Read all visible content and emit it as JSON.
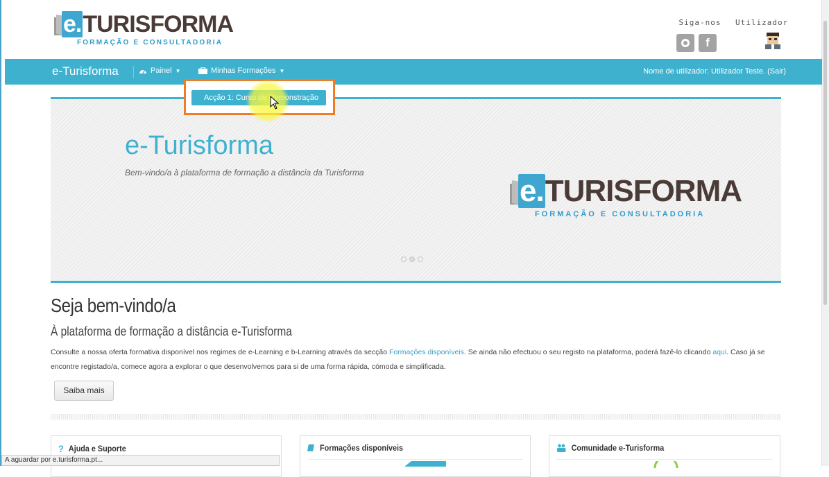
{
  "header": {
    "logo_text_e": "e.",
    "logo_text_rest": "TURISFORMA",
    "logo_tagline": "FORMAÇÃO E CONSULTADORIA",
    "follow_label": "Siga-nos",
    "user_label": "Utilizador"
  },
  "navbar": {
    "brand": "e-Turisforma",
    "panel": "Painel",
    "my_courses": "Minhas Formações",
    "user_text": "Nome de utilizador: Utilizador Teste. (Sair)"
  },
  "dropdown": {
    "item": "Acção 1: Curso de Demonstração"
  },
  "hero": {
    "title": "e-Turisforma",
    "subtitle": "Bem-vindo/a à plataforma de formação a distância da Turisforma",
    "logo_text_e": "e.",
    "logo_text_rest": "TURISFORMA",
    "logo_tagline": "FORMAÇÃO E CONSULTADORIA"
  },
  "welcome": {
    "title": "Seja bem-vindo/a",
    "subtitle": "À plataforma de formação a distância e-Turisforma",
    "text_1": "Consulte a nossa oferta formativa disponível nos regimes de e-Learning e b-Learning através da secção ",
    "link_1": "Formações disponíveis",
    "text_2": ". Se ainda não efectuou o seu registo na plataforma, poderá fazê-lo clicando ",
    "link_2": "aqui",
    "text_3": ". Caso já se encontre registado/a, comece agora a explorar o que desenvolvemos para si de uma forma rápida, cómoda  e simplificada.",
    "button": "Saiba mais"
  },
  "cards": [
    {
      "title": "Ajuda e Suporte",
      "icon": "?"
    },
    {
      "title": "Formações disponíveis",
      "icon": "book-icon"
    },
    {
      "title": "Comunidade e-Turisforma",
      "icon": "users-icon"
    }
  ],
  "status": "A aguardar por e.turisforma.pt..."
}
